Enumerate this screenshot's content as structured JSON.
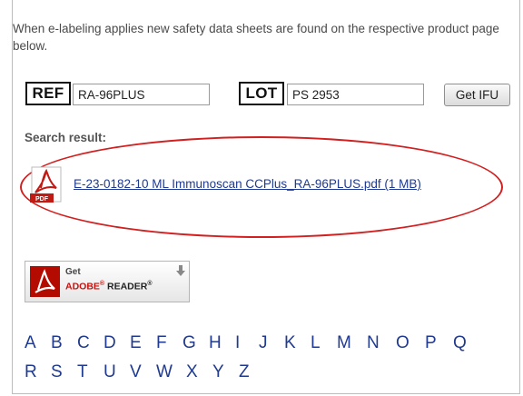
{
  "intro_text": "When e-labeling applies new safety data sheets are found on the respective product page below.",
  "ref": {
    "symbol": "REF",
    "value": "RA-96PLUS"
  },
  "lot": {
    "symbol": "LOT",
    "value": "PS 2953"
  },
  "get_ifu_label": "Get IFU",
  "search_result_label": "Search result:",
  "result_file": {
    "icon": "pdf-icon",
    "icon_caption": "PDF",
    "link_text": "E-23-0182-10 ML Immunoscan CCPlus_RA-96PLUS.pdf (1 MB)"
  },
  "adobe_button": {
    "get": "Get",
    "brand": "ADOBE",
    "reg1": "®",
    "product": " READER",
    "reg2": "®"
  },
  "alphabet_row1": [
    "A",
    "B",
    "C",
    "D",
    "E",
    "F",
    "G",
    "H",
    "I",
    "J",
    "K",
    "L",
    "M",
    "N",
    "O",
    "P",
    "Q"
  ],
  "alphabet_row2": [
    "R",
    "S",
    "T",
    "U",
    "V",
    "W",
    "X",
    "Y",
    "Z"
  ],
  "colors": {
    "link": "#1f3a8f",
    "highlight_oval": "#d21f1f",
    "adobe_red": "#b30b00"
  }
}
